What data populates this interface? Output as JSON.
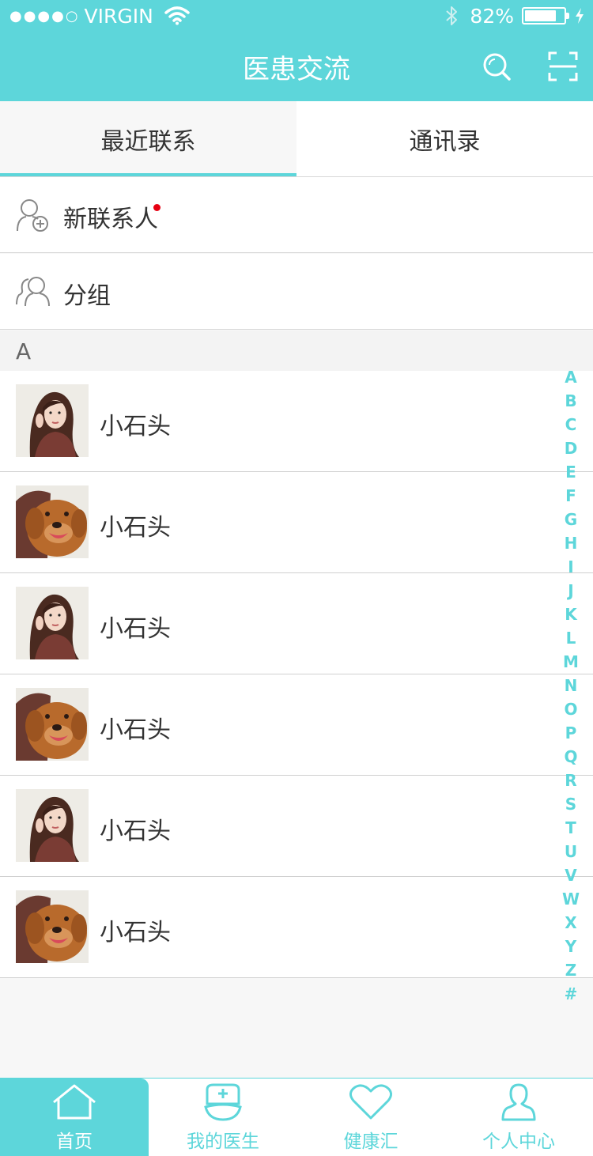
{
  "status_bar": {
    "signal_dots": "●●●●○",
    "carrier": "VIRGIN",
    "battery": "82%",
    "battery_level": 0.82
  },
  "header": {
    "title": "医患交流",
    "search_icon": "search-icon",
    "scan_icon": "scan-icon"
  },
  "tabs": [
    {
      "label": "最近联系",
      "active": true
    },
    {
      "label": "通讯录",
      "active": false
    }
  ],
  "menu": [
    {
      "label": "新联系人",
      "icon": "add-contact-icon",
      "badge": true
    },
    {
      "label": "分组",
      "icon": "group-icon",
      "badge": false
    }
  ],
  "section": {
    "letter": "A"
  },
  "contacts": [
    {
      "name": "小石头",
      "avatar": "girl-avatar"
    },
    {
      "name": "小石头",
      "avatar": "dog-avatar"
    },
    {
      "name": "小石头",
      "avatar": "girl-avatar"
    },
    {
      "name": "小石头",
      "avatar": "dog-avatar"
    },
    {
      "name": "小石头",
      "avatar": "girl-avatar"
    },
    {
      "name": "小石头",
      "avatar": "dog-avatar"
    }
  ],
  "alpha_index": [
    "A",
    "B",
    "C",
    "D",
    "E",
    "F",
    "G",
    "H",
    "I",
    "J",
    "K",
    "L",
    "M",
    "N",
    "O",
    "P",
    "Q",
    "R",
    "S",
    "T",
    "U",
    "V",
    "W",
    "X",
    "Y",
    "Z",
    "#"
  ],
  "tabbar": [
    {
      "label": "首页",
      "icon": "home-icon",
      "active": true
    },
    {
      "label": "我的医生",
      "icon": "nurse-cap-icon",
      "active": false
    },
    {
      "label": "健康汇",
      "icon": "heart-icon",
      "active": false
    },
    {
      "label": "个人中心",
      "icon": "person-icon",
      "active": false
    }
  ],
  "colors": {
    "accent": "#5dd6da",
    "badge": "#e60012",
    "text": "#333333"
  }
}
